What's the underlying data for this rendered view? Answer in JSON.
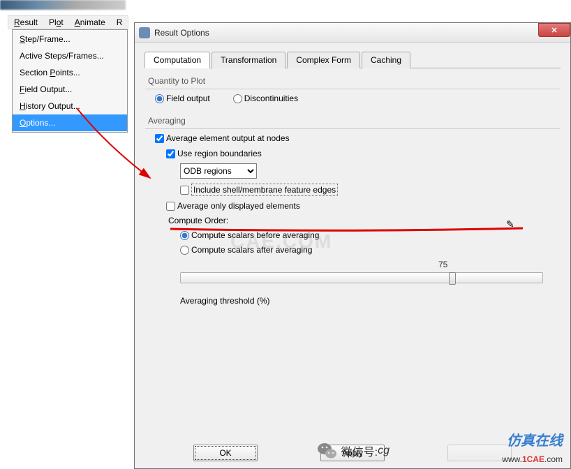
{
  "menubar": {
    "result": "Result",
    "plot": "Plot",
    "animate": "Animate",
    "r_partial": "R"
  },
  "dropdown": {
    "step_frame": "Step/Frame...",
    "active_steps": "Active Steps/Frames...",
    "section_points": "Section Points...",
    "field_output": "Field Output...",
    "history_output": "History Output...",
    "options": "Options..."
  },
  "dialog": {
    "title": "Result Options",
    "tabs": {
      "computation": "Computation",
      "transformation": "Transformation",
      "complex_form": "Complex Form",
      "caching": "Caching"
    },
    "quantity": {
      "group_title": "Quantity to Plot",
      "field_output": "Field output",
      "discontinuities": "Discontinuities"
    },
    "averaging": {
      "group_title": "Averaging",
      "avg_nodes": "Average element output at nodes",
      "use_region": "Use region boundaries",
      "region_sel": "ODB regions",
      "include_shell": "Include shell/membrane feature edges",
      "avg_displayed": "Average only displayed elements",
      "compute_order": "Compute Order:",
      "scalars_before": "Compute scalars before averaging",
      "scalars_after": "Compute scalars after averaging",
      "threshold_value": "75",
      "threshold_label": "Averaging threshold (%)"
    },
    "buttons": {
      "ok": "OK",
      "apply": "Apply"
    }
  },
  "watermarks": {
    "cae": "CAE.COM",
    "weixin_label": "微信号:",
    "weixin_id": "cg",
    "cn": "仿真在线",
    "url_pre": "www.",
    "url_main": "1CAE",
    "url_post": ".com"
  }
}
